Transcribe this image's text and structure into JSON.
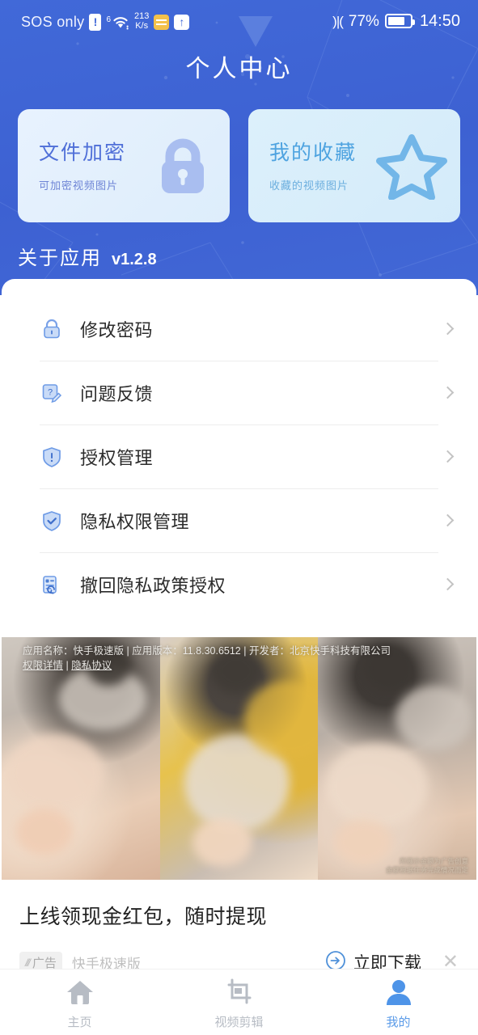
{
  "statusbar": {
    "carrier": "SOS only",
    "sim_icon": "sim-warning-icon",
    "wifi_icon": "wifi-icon",
    "wifi_superscript": "6",
    "net_speed_value": "213",
    "net_speed_unit": "K/s",
    "notif_icon_1": "calendar-badge-icon",
    "notif_icon_2": "upload-badge-icon",
    "vibrate_icon": "vibrate-icon",
    "battery_percent": "77%",
    "battery_icon": "battery-icon",
    "clock": "14:50"
  },
  "header": {
    "title": "个人中心",
    "accent_blue": "#4169D8",
    "cards": [
      {
        "title": "文件加密",
        "subtitle": "可加密视频图片",
        "icon": "lock-icon",
        "icon_color": "#A9BEF0",
        "title_color": "#4F6FD8",
        "bg": "#E4F0FC"
      },
      {
        "title": "我的收藏",
        "subtitle": "收藏的视频图片",
        "icon": "star-icon",
        "icon_color": "#72B6E8",
        "title_color": "#4EA3E0",
        "bg": "#DCF0FB"
      }
    ],
    "about_label": "关于应用",
    "about_version": "v1.2.8"
  },
  "menu": {
    "items": [
      {
        "label": "修改密码",
        "icon": "lock-outline-icon",
        "chevron": "chevron-right-icon"
      },
      {
        "label": "问题反馈",
        "icon": "feedback-pencil-icon",
        "chevron": "chevron-right-icon"
      },
      {
        "label": "授权管理",
        "icon": "shield-exclamation-icon",
        "chevron": "chevron-right-icon"
      },
      {
        "label": "隐私权限管理",
        "icon": "shield-check-icon",
        "chevron": "chevron-right-icon"
      },
      {
        "label": "撤回隐私政策授权",
        "icon": "document-revoke-icon",
        "chevron": "chevron-right-icon"
      }
    ]
  },
  "ad": {
    "info_line1": "应用名称：快手极速版 | 应用版本：11.8.30.6512 | 开发者：北京快手科技有限公司",
    "info_permission": "权限详情",
    "info_separator": " | ",
    "info_privacy": "隐私协议",
    "watermark_line1": "所展示金额为广告创意",
    "watermark_line2": "金额根据任务完成情况而定",
    "title": "上线领现金红包，随时提现",
    "tag_label": "广告",
    "tag_icon": "ad-bars-icon",
    "brand": "快手极速版",
    "cta_label": "立即下载",
    "cta_icon": "arrow-circle-right-icon",
    "close_icon": "close-icon"
  },
  "bottomnav": {
    "items": [
      {
        "label": "主页",
        "icon": "home-icon",
        "active": false
      },
      {
        "label": "视频剪辑",
        "icon": "crop-icon",
        "active": false
      },
      {
        "label": "我的",
        "icon": "person-icon",
        "active": true
      }
    ],
    "active_color": "#5B9BE8",
    "inactive_color": "#B7BCC4"
  }
}
